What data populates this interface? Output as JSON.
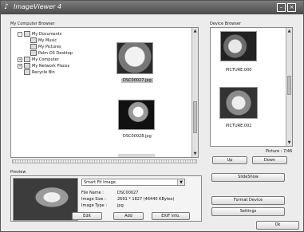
{
  "window": {
    "title": "ImageViewer 4"
  },
  "browser": {
    "label": "My Computer Browser",
    "tree": [
      {
        "label": "My Documents",
        "expander": "⊟"
      },
      {
        "label": "My Music"
      },
      {
        "label": "My Pictures"
      },
      {
        "label": "Palm OS Desktop"
      },
      {
        "label": "My Computer",
        "expander": "⊞"
      },
      {
        "label": "My Network Places",
        "expander": "⊞"
      },
      {
        "label": "Recycle Bin"
      }
    ],
    "thumbnails": [
      {
        "filename": "DSC00027.jpg",
        "selected": true
      },
      {
        "filename": "DSC00028.jpg",
        "selected": false
      }
    ]
  },
  "device": {
    "label": "Device Browser",
    "thumbnails": [
      {
        "filename": "PICTURE.000"
      },
      {
        "filename": "PICTURE.001"
      }
    ],
    "picture_count": "Picture : 7/46",
    "up_label": "Up",
    "down_label": "Down"
  },
  "preview": {
    "label": "Preview",
    "fit_select": "Smart Fit Image.",
    "file_name_label": "File Name :",
    "file_name": "DSC00027",
    "image_size_label": "Image Size :",
    "image_size": "2691 * 1827 (46440 KBytes)",
    "image_type_label": "Image Type :",
    "image_type": "jpg",
    "edit_label": "Edit",
    "add_label": "Add",
    "exif_label": "EXIF Info."
  },
  "actions": {
    "slideshow": "SlideShow",
    "format_device": "Format Device",
    "settings": "Settings",
    "ok": "Ok"
  },
  "colors": {
    "title_bar": "#5b5b5b",
    "selected": "#bfbfbf"
  }
}
